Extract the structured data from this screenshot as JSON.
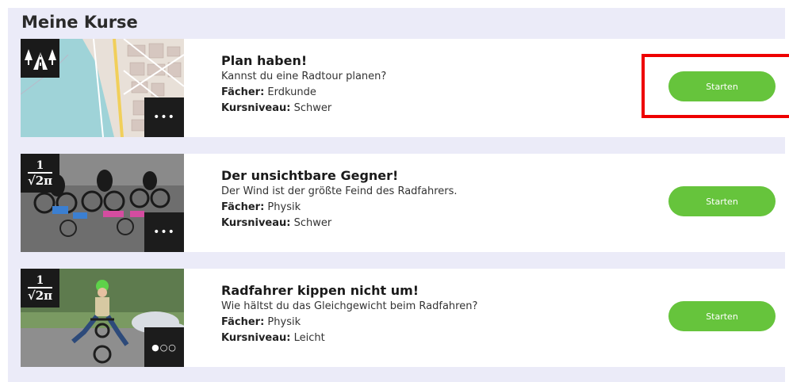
{
  "page_title": "Meine Kurse",
  "labels": {
    "subjects": "Fächer:",
    "level": "Kursniveau:"
  },
  "math_badge": {
    "numerator": "1",
    "denominator": "√2π"
  },
  "courses": [
    {
      "title": "Plan haben!",
      "description": "Kannst du eine Radtour planen?",
      "subject": "Erdkunde",
      "level": "Schwer",
      "button": "Starten",
      "more": "•••",
      "badge_icon": "forest-road-icon"
    },
    {
      "title": "Der unsichtbare Gegner!",
      "description": "Der Wind ist der größte Feind des Radfahrers.",
      "subject": "Physik",
      "level": "Schwer",
      "button": "Starten",
      "more": "•••",
      "badge_icon": "math-formula-icon"
    },
    {
      "title": "Radfahrer kippen nicht um!",
      "description": "Wie hältst du das Gleichgewicht beim Radfahren?",
      "subject": "Physik",
      "level": "Leicht",
      "button": "Starten",
      "more": "●○○",
      "badge_icon": "math-formula-icon"
    }
  ],
  "colors": {
    "accent": "#66c43c",
    "panel": "#ebebf8",
    "highlight": "#ee0000"
  }
}
